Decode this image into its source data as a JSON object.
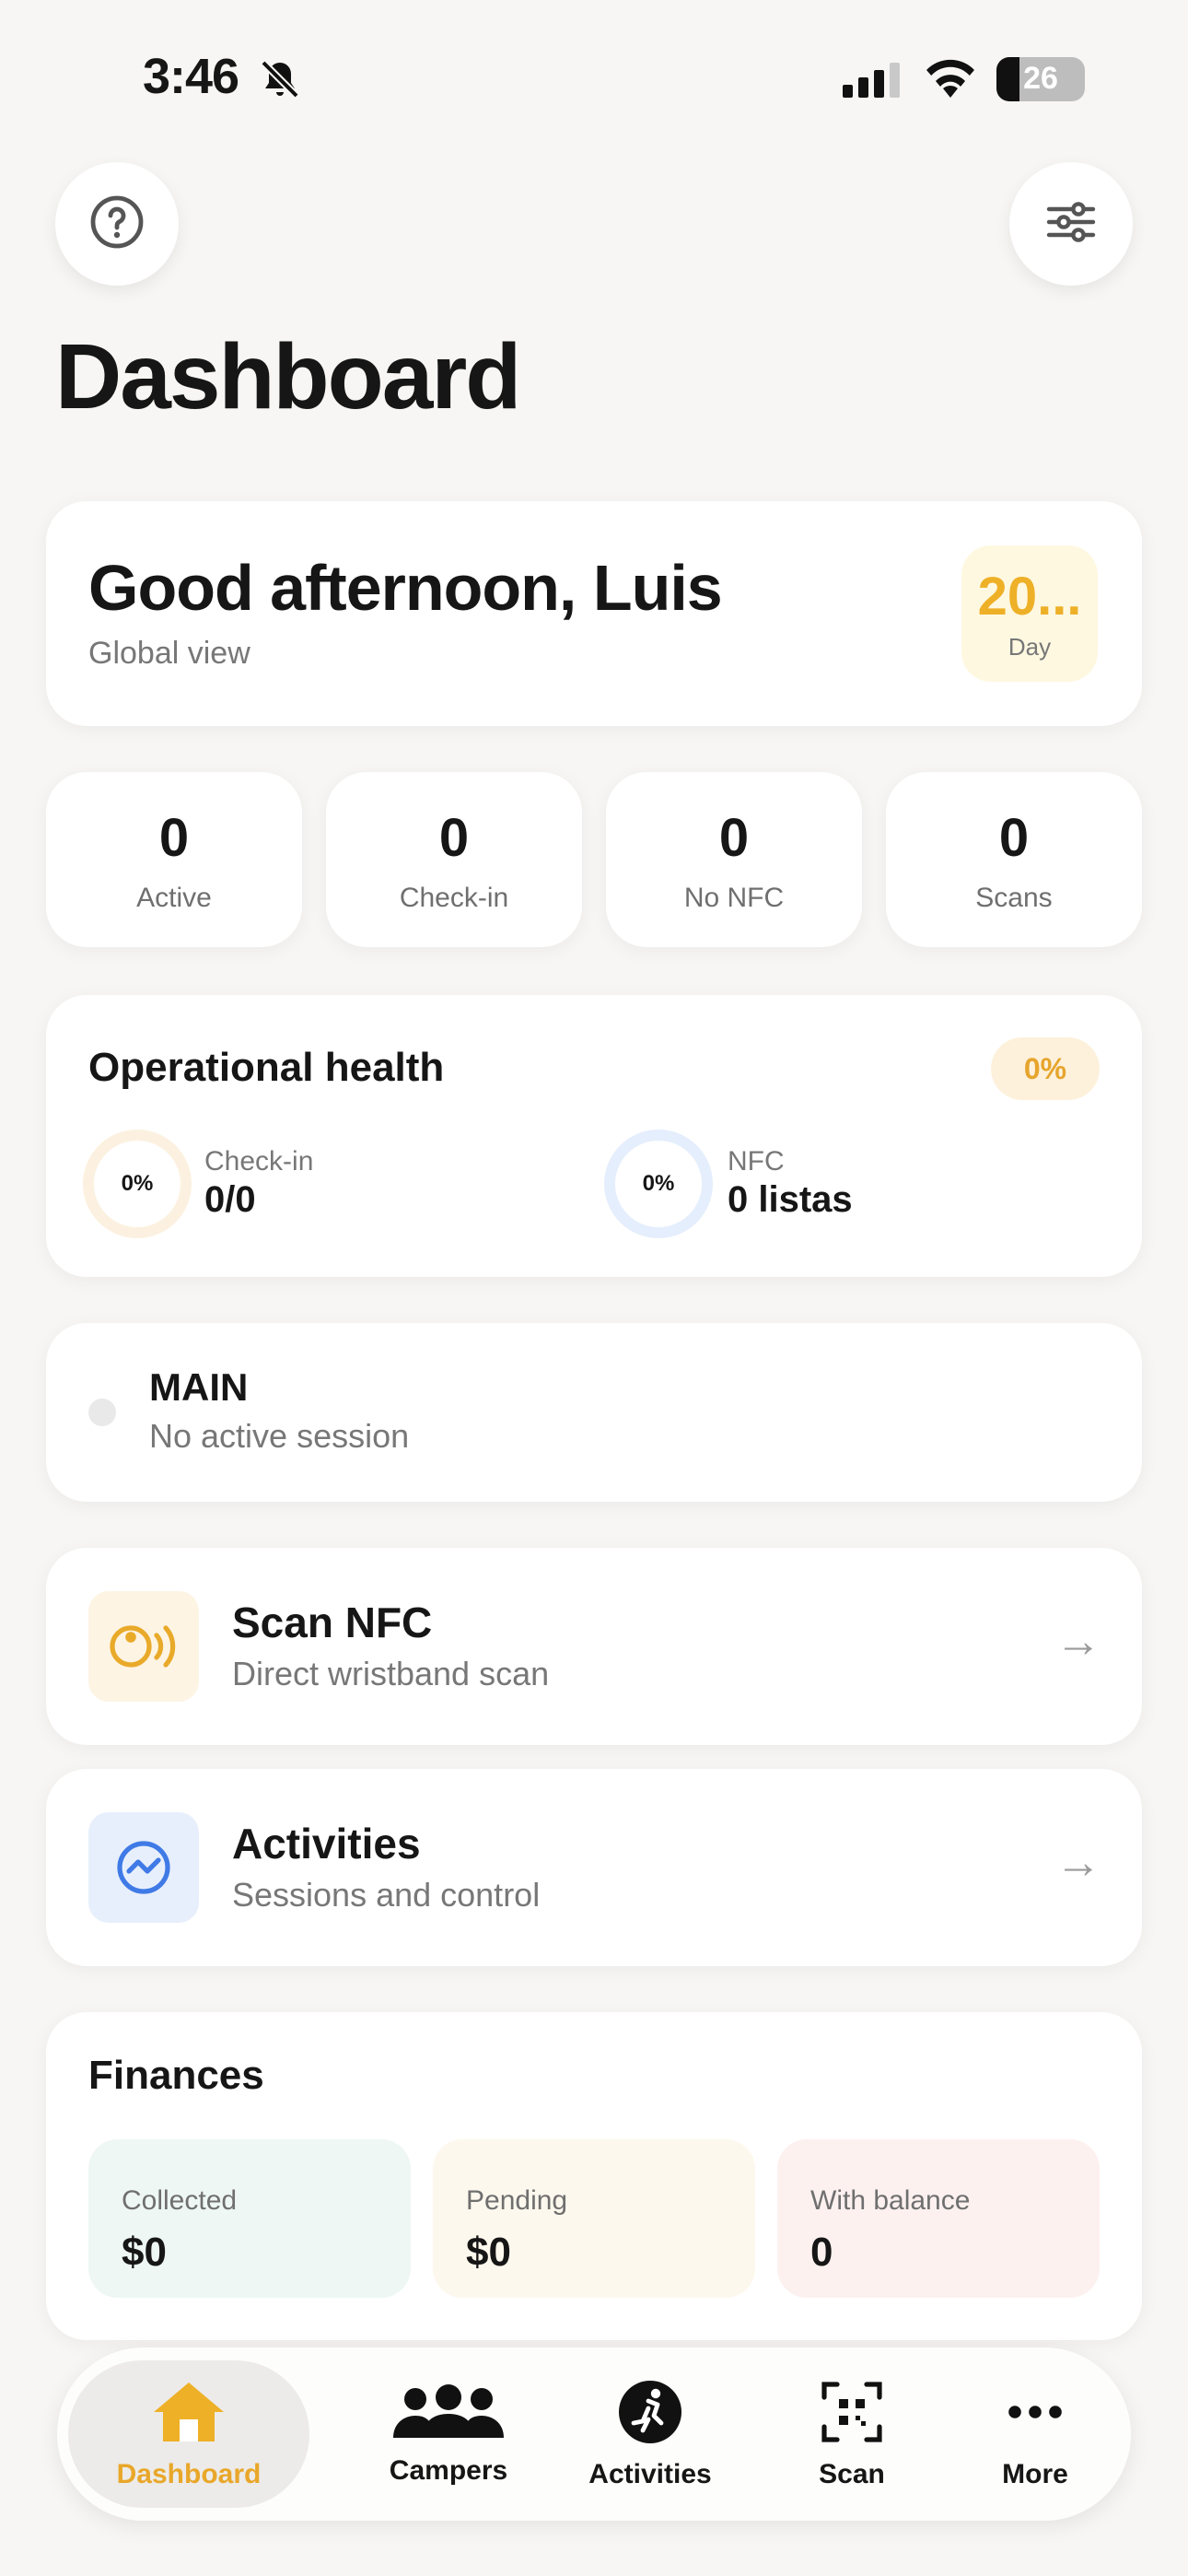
{
  "status_bar": {
    "time": "3:46",
    "battery": "26"
  },
  "header": {
    "title": "Dashboard"
  },
  "greeting": {
    "title": "Good afternoon, Luis",
    "subtitle": "Global view",
    "day_value": "20...",
    "day_label": "Day"
  },
  "stats": [
    {
      "value": "0",
      "label": "Active"
    },
    {
      "value": "0",
      "label": "Check-in"
    },
    {
      "value": "0",
      "label": "No NFC"
    },
    {
      "value": "0",
      "label": "Scans"
    }
  ],
  "health": {
    "title": "Operational health",
    "badge": "0%",
    "checkin": {
      "ring": "0%",
      "label": "Check-in",
      "value": "0/0"
    },
    "nfc": {
      "ring": "0%",
      "label": "NFC",
      "value": "0 listas"
    }
  },
  "session": {
    "title": "MAIN",
    "subtitle": "No active session"
  },
  "actions": {
    "scan": {
      "title": "Scan NFC",
      "subtitle": "Direct wristband scan",
      "icon": "nfc-icon"
    },
    "activities": {
      "title": "Activities",
      "subtitle": "Sessions and control",
      "icon": "activity-icon"
    }
  },
  "finances": {
    "title": "Finances",
    "collected": {
      "label": "Collected",
      "value": "$0"
    },
    "pending": {
      "label": "Pending",
      "value": "$0"
    },
    "balance": {
      "label": "With balance",
      "value": "0"
    }
  },
  "tabs": [
    {
      "label": "Dashboard",
      "icon": "home-icon"
    },
    {
      "label": "Campers",
      "icon": "people-icon"
    },
    {
      "label": "Activities",
      "icon": "running-icon"
    },
    {
      "label": "Scan",
      "icon": "qr-icon"
    },
    {
      "label": "More",
      "icon": "more-icon"
    }
  ],
  "colors": {
    "accent": "#eeb027",
    "background": "#f7f6f4",
    "blue": "#3f7ae6"
  }
}
